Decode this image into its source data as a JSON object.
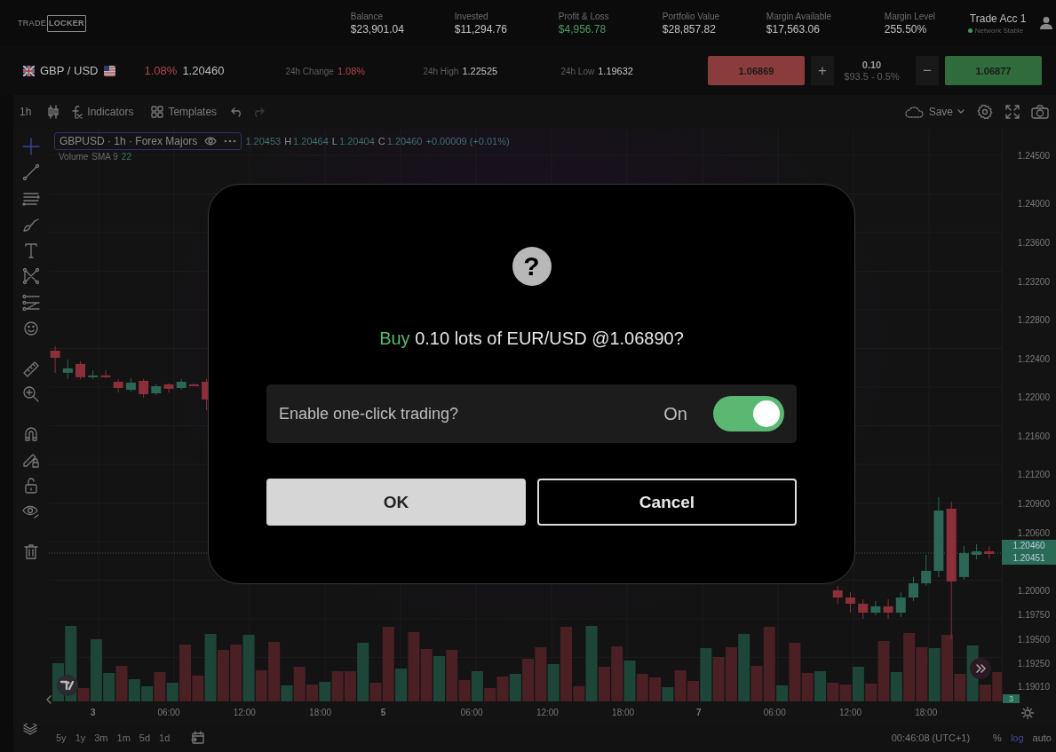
{
  "logo": {
    "part_1": "TRADE",
    "part_2": "LOCKER"
  },
  "account_stats": [
    {
      "label": "Balance",
      "value": "$23,901.04",
      "kind": "plain"
    },
    {
      "label": "Invested",
      "value": "$11,294.76",
      "kind": "plain"
    },
    {
      "label": "Profit & Loss",
      "value": "$4,956.78",
      "kind": "gain"
    },
    {
      "label": "Portfolio Value",
      "value": "$28,857.82",
      "kind": "plain"
    },
    {
      "label": "Margin Available",
      "value": "$17,563.06",
      "kind": "plain"
    },
    {
      "label": "Margin Level",
      "value": "255.50%",
      "kind": "plain"
    }
  ],
  "account": {
    "name": "Trade Acc 1",
    "status": "Network Stable",
    "connected": true
  },
  "instrument": {
    "pair": "GBP / USD",
    "change": "1.08%",
    "negative": true,
    "price": "1.20460",
    "stats": [
      {
        "label": "24h Change",
        "value": "1.08%",
        "kind": "loss"
      },
      {
        "label": "24h High",
        "value": "1.22525",
        "kind": "plain"
      },
      {
        "label": "24h Low",
        "value": "1.19632",
        "kind": "plain"
      }
    ]
  },
  "trade": {
    "sell_price": "1.06869",
    "plus": "+",
    "quantity": "0.10",
    "quantity_note": "$93.5 - 0.5%",
    "minus": "−",
    "buy_price": "1.06877"
  },
  "chart_toolbar": {
    "interval": "1h",
    "indicators": "Indicators",
    "templates": "Templates",
    "save": "Save"
  },
  "legend": {
    "title": "GBPUSD · 1h · Forex Majors",
    "ohlc": [
      {
        "value": "1.20453"
      },
      {
        "label": "H",
        "value": "1.20464"
      },
      {
        "label": "L",
        "value": "1.20404"
      },
      {
        "label": "C",
        "value": "1.20460"
      }
    ],
    "change": "+0.00009 (+0.01%)"
  },
  "volume_legend": {
    "name": "Volume",
    "params": "SMA 9",
    "value": "22"
  },
  "chart_data": {
    "type": "candlestick",
    "categories": [
      null,
      null,
      null,
      "3",
      null,
      null,
      null,
      null,
      null,
      "06:00",
      null,
      null,
      null,
      null,
      null,
      "12:00",
      null,
      null,
      null,
      null,
      null,
      "18:00",
      null,
      null,
      null,
      null,
      "5",
      null,
      null,
      null,
      null,
      null,
      null,
      "06:00",
      null,
      null,
      null,
      null,
      null,
      "12:00",
      null,
      null,
      null,
      null,
      null,
      "18:00",
      null,
      null,
      null,
      null,
      null,
      "7",
      null,
      null,
      null,
      null,
      null,
      "06:00",
      null,
      null,
      null,
      null,
      null,
      "12:00",
      null,
      null,
      null,
      null,
      null,
      "18:00",
      null,
      null,
      null,
      null,
      null
    ],
    "ohlc": [
      [
        1.2248,
        1.22526,
        1.22251,
        1.22407
      ],
      [
        1.22251,
        1.22389,
        1.22187,
        1.22297
      ],
      [
        1.22343,
        1.2237,
        1.22187,
        1.22205
      ],
      [
        1.22214,
        1.22278,
        1.22187,
        1.22224
      ],
      [
        1.22224,
        1.22278,
        1.22196,
        1.22214
      ],
      [
        1.22159,
        1.22187,
        1.22049,
        1.22095
      ],
      [
        1.22076,
        1.22196,
        1.22058,
        1.2215
      ],
      [
        1.22168,
        1.22187,
        1.21994,
        1.22031
      ],
      [
        1.2204,
        1.22132,
        1.22021,
        1.22113
      ],
      [
        1.22132,
        1.22141,
        1.22049,
        1.22086
      ],
      [
        1.22095,
        1.22187,
        1.22076,
        1.22159
      ],
      [
        1.22132,
        1.22141,
        1.22122,
        1.22122
      ],
      [
        1.22159,
        1.22187,
        1.21865,
        1.21975
      ],
      null,
      null,
      null,
      null,
      null,
      null,
      null,
      null,
      null,
      null,
      null,
      null,
      null,
      null,
      null,
      null,
      null,
      null,
      null,
      null,
      null,
      null,
      null,
      null,
      null,
      null,
      null,
      null,
      null,
      null,
      null,
      null,
      null,
      null,
      null,
      null,
      null,
      null,
      null,
      null,
      null,
      null,
      null,
      null,
      null,
      null,
      null,
      null,
      null,
      [
        1.20002,
        1.20048,
        1.19864,
        1.19928
      ],
      [
        1.19928,
        1.19983,
        1.19772,
        1.19864
      ],
      [
        1.19864,
        1.1991,
        1.19708,
        1.19772
      ],
      [
        1.19772,
        1.19892,
        1.19745,
        1.19837
      ],
      [
        1.19837,
        1.1991,
        1.19708,
        1.19772
      ],
      [
        1.19772,
        1.19983,
        1.19726,
        1.19928
      ],
      [
        1.19928,
        1.2014,
        1.19892,
        1.20075
      ],
      [
        1.20075,
        1.20369,
        1.20048,
        1.20204
      ],
      [
        1.20204,
        1.20966,
        1.2014,
        1.20828
      ],
      [
        1.20846,
        1.2092,
        1.195,
        1.20094
      ],
      [
        1.2014,
        1.20461,
        1.20112,
        1.20387
      ],
      [
        1.20369,
        1.20479,
        1.20323,
        1.20406
      ],
      [
        1.20406,
        1.20461,
        1.20332,
        1.20378
      ]
    ],
    "ylim": [
      1.18854,
      1.24775
    ],
    "yticks": [
      {
        "value": 1.245,
        "label": "1.24500"
      },
      {
        "value": 1.24,
        "label": "1.24000"
      },
      {
        "value": 1.236,
        "label": "1.23600"
      },
      {
        "value": 1.232,
        "label": "1.23200"
      },
      {
        "value": 1.228,
        "label": "1.22800"
      },
      {
        "value": 1.224,
        "label": "1.22400"
      },
      {
        "value": 1.22,
        "label": "1.22000"
      },
      {
        "value": 1.216,
        "label": "1.21600"
      },
      {
        "value": 1.212,
        "label": "1.21200"
      },
      {
        "value": 1.209,
        "label": "1.20900"
      },
      {
        "value": 1.206,
        "label": "1.20600"
      },
      {
        "value": 1.2,
        "label": "1.20000"
      },
      {
        "value": 1.1975,
        "label": "1.19750"
      },
      {
        "value": 1.195,
        "label": "1.19500"
      },
      {
        "value": 1.1925,
        "label": "1.19250"
      },
      {
        "value": 1.1901,
        "label": "1.19010"
      }
    ]
  },
  "time_labels_bold": [
    true,
    false,
    false,
    false,
    true,
    false,
    false,
    false,
    true,
    false,
    false,
    false
  ],
  "price_tags": [
    "1.20460",
    "1.20451"
  ],
  "volume_tag": "3",
  "ranges": [
    "5y",
    "1y",
    "3m",
    "1m",
    "5d",
    "1d"
  ],
  "clock": "00:46:08 (UTC+1)",
  "scale_options": [
    {
      "label": "%",
      "selected": false
    },
    {
      "label": "log",
      "selected": true
    },
    {
      "label": "auto",
      "selected": false
    }
  ],
  "dialog": {
    "icon": "?",
    "side": "Buy",
    "message": "0.10 lots of EUR/USD @1.06890?",
    "option": {
      "label": "Enable one-click trading?",
      "state_text": "On",
      "on": true
    },
    "buttons": [
      {
        "label": "OK",
        "kind": "primary"
      },
      {
        "label": "Cancel",
        "kind": "secondary"
      }
    ]
  }
}
